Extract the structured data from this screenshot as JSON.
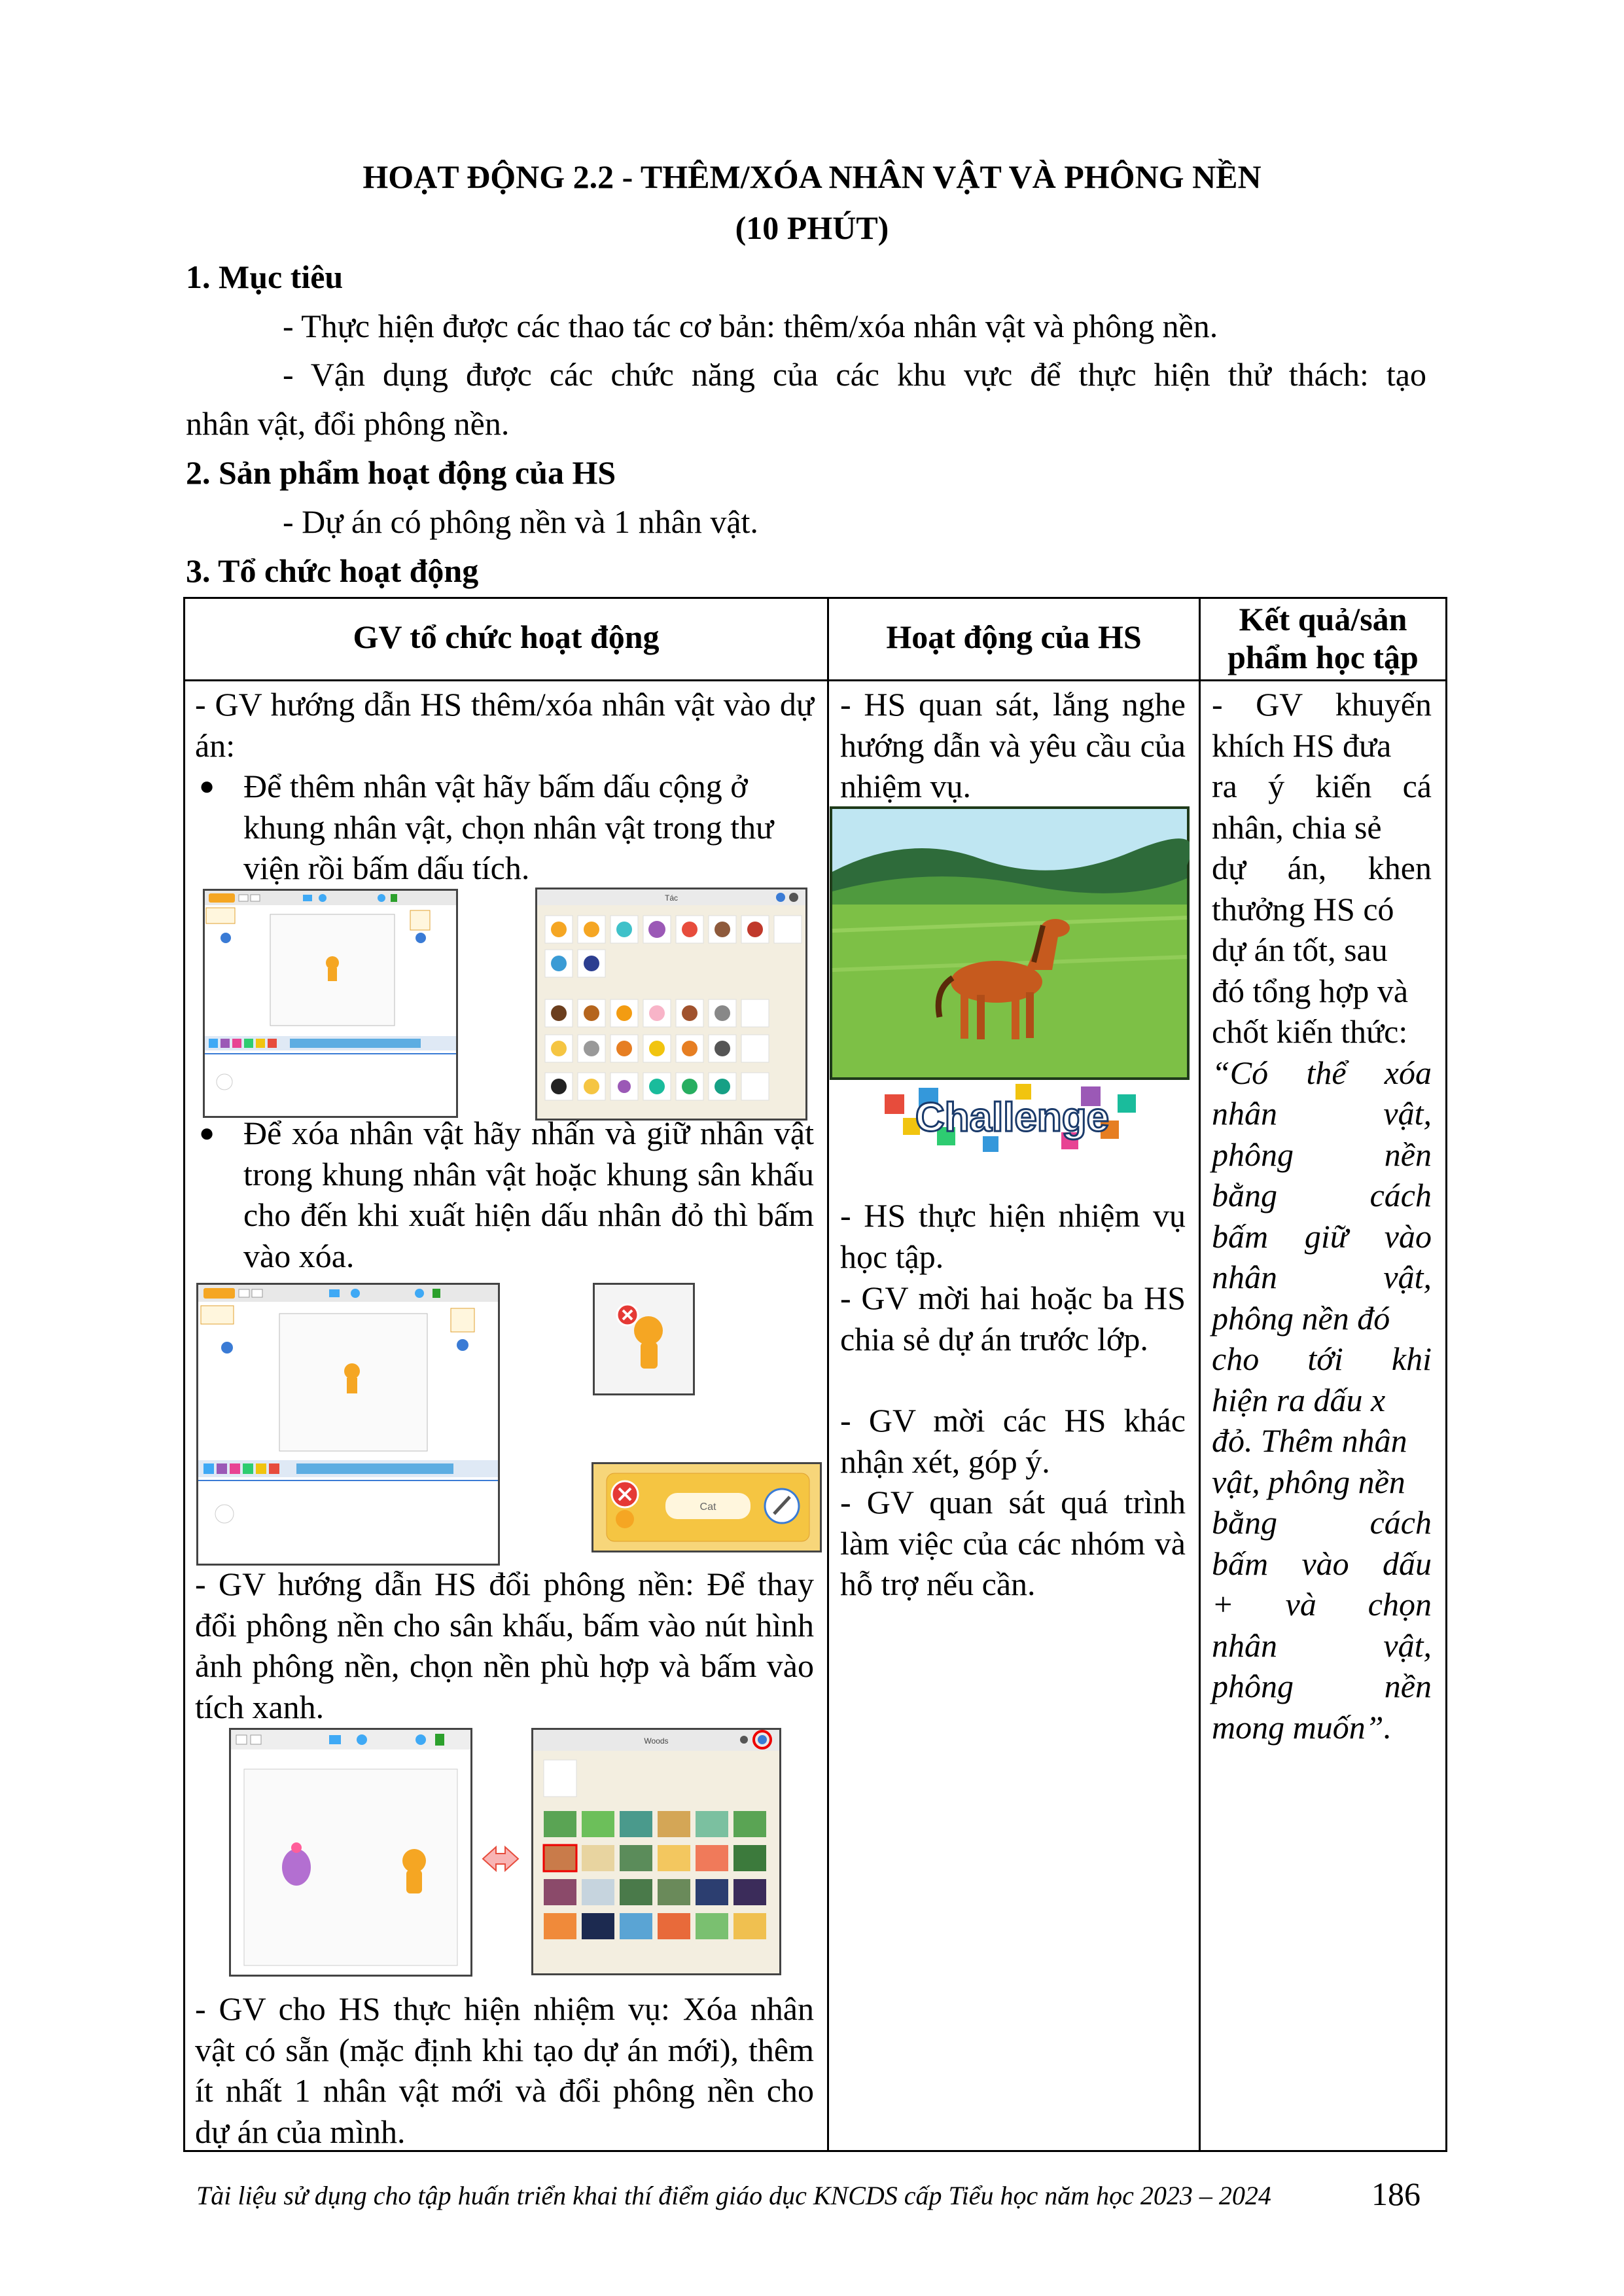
{
  "title": {
    "line1": "HOẠT ĐỘNG 2.2 - THÊM/XÓA NHÂN VẬT VÀ PHÔNG NỀN",
    "line2": "(10 PHÚT)"
  },
  "section1": {
    "heading": "1. Mục tiêu",
    "p1": "- Thực hiện được các thao tác cơ bản: thêm/xóa nhân vật và phông nền.",
    "p2_line1": "- Vận dụng được các chức năng của các khu vực để thực hiện thử thách: tạo",
    "p2_line2": "nhân vật, đổi phông nền."
  },
  "section2": {
    "heading": "2. Sản phẩm hoạt động của HS",
    "p1": "- Dự án có phông nền và 1 nhân vật."
  },
  "section3": {
    "heading": "3. Tổ chức hoạt động"
  },
  "table": {
    "headers": {
      "col1": "GV tổ chức hoạt động",
      "col2": "Hoạt động của HS",
      "col3_line1": "Kết quả/sản",
      "col3_line2": "phẩm học tập"
    },
    "col1": {
      "intro": "- GV hướng dẫn HS thêm/xóa nhân vật vào dự án:",
      "bullet1": "Để thêm nhân vật hãy bấm dấu cộng ở khung nhân vật, chọn nhân vật trong thư viện rồi bấm dấu tích.",
      "bullet2": "Để xóa nhân vật hãy nhấn và giữ nhân vật trong khung nhân vật hoặc khung sân khấu cho đến khi xuất hiện dấu nhân đỏ thì bấm vào xóa.",
      "bg_instruction": "- GV hướng dẫn HS đổi phông nền: Để thay đổi phông nền cho sân khấu, bấm vào nút hình ảnh phông nền, chọn nền phù hợp và bấm vào tích xanh.",
      "task": "- GV cho HS thực hiện nhiệm vụ: Xóa nhân vật có sẵn (mặc định khi tạo dự án mới), thêm ít nhất 1 nhân vật mới và đổi phông nền cho dự án của mình.",
      "library_title": "Tác",
      "woods_title": "Woods",
      "cat_label": "Cat"
    },
    "col2": {
      "p1": "- HS quan sát, lắng nghe hướng dẫn và yêu cầu của nhiệm vụ.",
      "challenge_word": "Challenge",
      "p2": "- HS thực hiện nhiệm vụ học tập.",
      "p3": "- GV mời hai hoặc ba HS chia sẻ dự án trước lớp.",
      "p4": "- GV mời các HS khác nhận xét, góp ý.",
      "p5": "- GV quan sát quá trình làm việc của các nhóm và hỗ trợ nếu cần."
    },
    "col3": {
      "lines": [
        "- GV khuyến",
        "khích HS đưa",
        "ra ý kiến cá",
        "nhân, chia sẻ",
        "dự án, khen",
        "thưởng HS có",
        "dự án tốt, sau",
        "đó tổng hợp và",
        "chốt kiến thức:",
        "“Có thể xóa",
        "nhân vật,",
        "phông nền",
        "bằng cách",
        "bấm giữ vào",
        "nhân vật,",
        "phông nền đó",
        "cho tới khi",
        "hiện ra dấu x",
        "đỏ. Thêm nhân",
        "vật, phông nền",
        "bằng cách",
        "bấm vào dấu",
        "+ và chọn",
        "nhân vật,",
        "phông nền",
        "mong muốn”."
      ]
    }
  },
  "footer": {
    "text": "Tài liệu sử dụng cho tập huấn triển khai thí điểm giáo dục KNCDS cấp Tiểu học năm học 2023 – 2024",
    "page": "186"
  }
}
